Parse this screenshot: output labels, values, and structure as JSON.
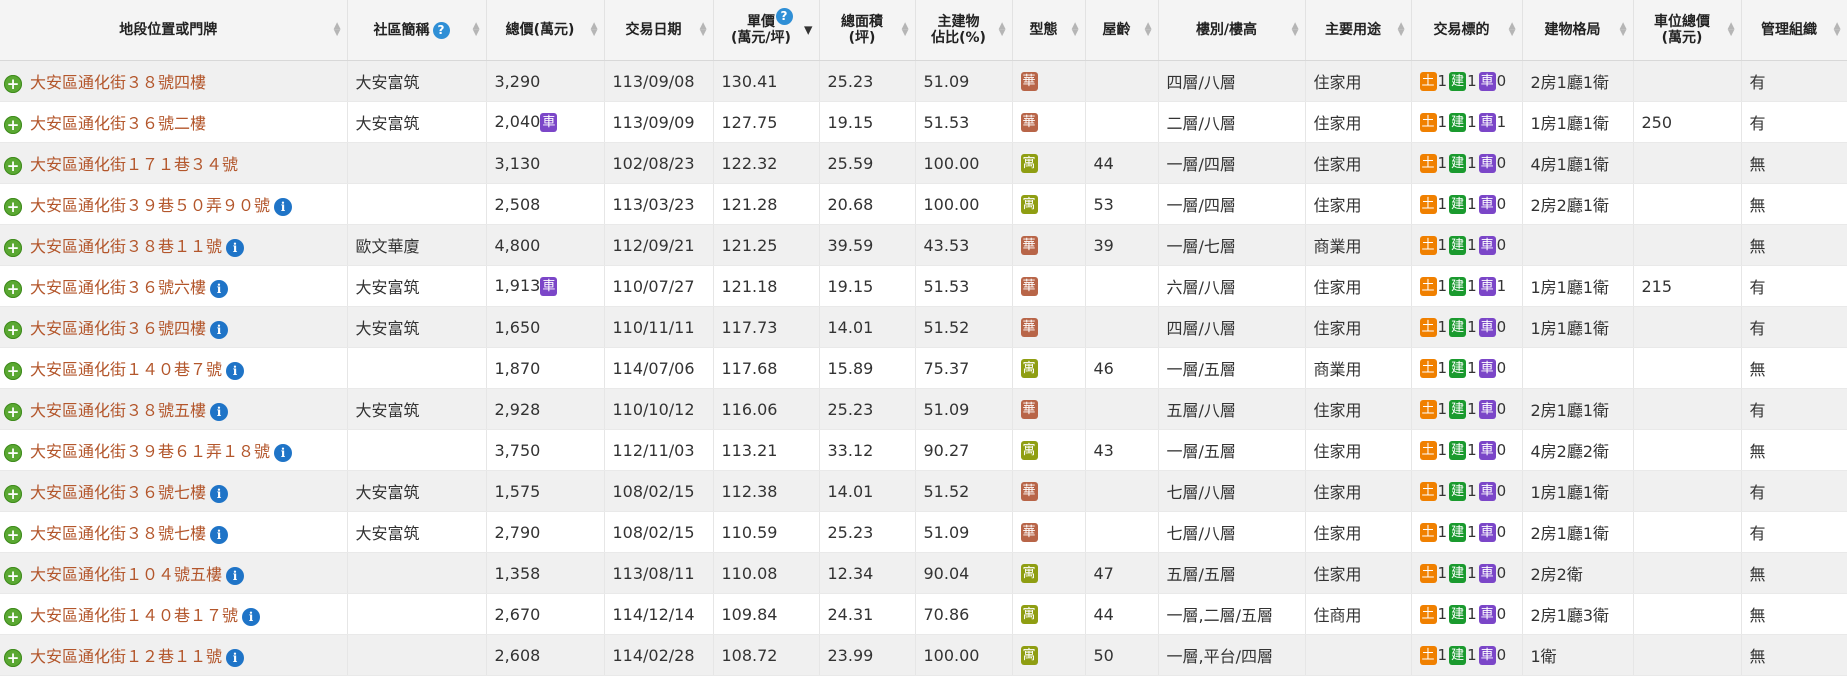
{
  "headers": {
    "address": "地段位置或門牌",
    "community": "社區簡稱",
    "total_price": "總價(萬元)",
    "date": "交易日期",
    "unit_price": "單價\n(萬元/坪)",
    "area": "總面積\n(坪)",
    "main_ratio": "主建物\n佔比(%)",
    "type": "型態",
    "age": "屋齡",
    "floor": "樓別/樓高",
    "usage": "主要用途",
    "target": "交易標的",
    "layout": "建物格局",
    "parking_price": "車位總價\n(萬元)",
    "management": "管理組織"
  },
  "badges": {
    "hua": "華",
    "yu": "寓",
    "che": "車",
    "land": "土",
    "building": "建"
  },
  "colors": {
    "address_text": "#b3562b",
    "hua": "#b86548",
    "yu": "#8f9e12",
    "che": "#7b46c8",
    "land": "#f08000",
    "building": "#1a9a2e",
    "plus": "#5aa832",
    "info": "#1f74c7"
  },
  "icons": {
    "expand": "plus-circle-icon",
    "info": "info-icon",
    "help": "question-icon",
    "sort": "sort-arrows-icon"
  },
  "rows": [
    {
      "address": "大安區通化街３８號四樓",
      "info": false,
      "community": "大安富筑",
      "total": "3,290",
      "parking": false,
      "date": "113/09/08",
      "unit": "130.41",
      "area": "25.23",
      "ratio": "51.09",
      "type": "hua",
      "age": "",
      "floor": "四層/八層",
      "usage": "住家用",
      "land": "1",
      "bld": "1",
      "car": "0",
      "layout": "2房1廳1衛",
      "parking_price": "",
      "mgmt": "有"
    },
    {
      "address": "大安區通化街３６號二樓",
      "info": false,
      "community": "大安富筑",
      "total": "2,040",
      "parking": true,
      "date": "113/09/09",
      "unit": "127.75",
      "area": "19.15",
      "ratio": "51.53",
      "type": "hua",
      "age": "",
      "floor": "二層/八層",
      "usage": "住家用",
      "land": "1",
      "bld": "1",
      "car": "1",
      "layout": "1房1廳1衛",
      "parking_price": "250",
      "mgmt": "有"
    },
    {
      "address": "大安區通化街１７１巷３４號",
      "info": false,
      "community": "",
      "total": "3,130",
      "parking": false,
      "date": "102/08/23",
      "unit": "122.32",
      "area": "25.59",
      "ratio": "100.00",
      "type": "yu",
      "age": "44",
      "floor": "一層/四層",
      "usage": "住家用",
      "land": "1",
      "bld": "1",
      "car": "0",
      "layout": "4房1廳1衛",
      "parking_price": "",
      "mgmt": "無"
    },
    {
      "address": "大安區通化街３９巷５０弄９０號",
      "info": true,
      "community": "",
      "total": "2,508",
      "parking": false,
      "date": "113/03/23",
      "unit": "121.28",
      "area": "20.68",
      "ratio": "100.00",
      "type": "yu",
      "age": "53",
      "floor": "一層/四層",
      "usage": "住家用",
      "land": "1",
      "bld": "1",
      "car": "0",
      "layout": "2房2廳1衛",
      "parking_price": "",
      "mgmt": "無"
    },
    {
      "address": "大安區通化街３８巷１１號",
      "info": true,
      "community": "歐文華廈",
      "total": "4,800",
      "parking": false,
      "date": "112/09/21",
      "unit": "121.25",
      "area": "39.59",
      "ratio": "43.53",
      "type": "hua",
      "age": "39",
      "floor": "一層/七層",
      "usage": "商業用",
      "land": "1",
      "bld": "1",
      "car": "0",
      "layout": "",
      "parking_price": "",
      "mgmt": "無"
    },
    {
      "address": "大安區通化街３６號六樓",
      "info": true,
      "community": "大安富筑",
      "total": "1,913",
      "parking": true,
      "date": "110/07/27",
      "unit": "121.18",
      "area": "19.15",
      "ratio": "51.53",
      "type": "hua",
      "age": "",
      "floor": "六層/八層",
      "usage": "住家用",
      "land": "1",
      "bld": "1",
      "car": "1",
      "layout": "1房1廳1衛",
      "parking_price": "215",
      "mgmt": "有"
    },
    {
      "address": "大安區通化街３６號四樓",
      "info": true,
      "community": "大安富筑",
      "total": "1,650",
      "parking": false,
      "date": "110/11/11",
      "unit": "117.73",
      "area": "14.01",
      "ratio": "51.52",
      "type": "hua",
      "age": "",
      "floor": "四層/八層",
      "usage": "住家用",
      "land": "1",
      "bld": "1",
      "car": "0",
      "layout": "1房1廳1衛",
      "parking_price": "",
      "mgmt": "有"
    },
    {
      "address": "大安區通化街１４０巷７號",
      "info": true,
      "community": "",
      "total": "1,870",
      "parking": false,
      "date": "114/07/06",
      "unit": "117.68",
      "area": "15.89",
      "ratio": "75.37",
      "type": "yu",
      "age": "46",
      "floor": "一層/五層",
      "usage": "商業用",
      "land": "1",
      "bld": "1",
      "car": "0",
      "layout": "",
      "parking_price": "",
      "mgmt": "無"
    },
    {
      "address": "大安區通化街３８號五樓",
      "info": true,
      "community": "大安富筑",
      "total": "2,928",
      "parking": false,
      "date": "110/10/12",
      "unit": "116.06",
      "area": "25.23",
      "ratio": "51.09",
      "type": "hua",
      "age": "",
      "floor": "五層/八層",
      "usage": "住家用",
      "land": "1",
      "bld": "1",
      "car": "0",
      "layout": "2房1廳1衛",
      "parking_price": "",
      "mgmt": "有"
    },
    {
      "address": "大安區通化街３９巷６１弄１８號",
      "info": true,
      "community": "",
      "total": "3,750",
      "parking": false,
      "date": "112/11/03",
      "unit": "113.21",
      "area": "33.12",
      "ratio": "90.27",
      "type": "yu",
      "age": "43",
      "floor": "一層/五層",
      "usage": "住家用",
      "land": "1",
      "bld": "1",
      "car": "0",
      "layout": "4房2廳2衛",
      "parking_price": "",
      "mgmt": "無"
    },
    {
      "address": "大安區通化街３６號七樓",
      "info": true,
      "community": "大安富筑",
      "total": "1,575",
      "parking": false,
      "date": "108/02/15",
      "unit": "112.38",
      "area": "14.01",
      "ratio": "51.52",
      "type": "hua",
      "age": "",
      "floor": "七層/八層",
      "usage": "住家用",
      "land": "1",
      "bld": "1",
      "car": "0",
      "layout": "1房1廳1衛",
      "parking_price": "",
      "mgmt": "有"
    },
    {
      "address": "大安區通化街３８號七樓",
      "info": true,
      "community": "大安富筑",
      "total": "2,790",
      "parking": false,
      "date": "108/02/15",
      "unit": "110.59",
      "area": "25.23",
      "ratio": "51.09",
      "type": "hua",
      "age": "",
      "floor": "七層/八層",
      "usage": "住家用",
      "land": "1",
      "bld": "1",
      "car": "0",
      "layout": "2房1廳1衛",
      "parking_price": "",
      "mgmt": "有"
    },
    {
      "address": "大安區通化街１０４號五樓",
      "info": true,
      "community": "",
      "total": "1,358",
      "parking": false,
      "date": "113/08/11",
      "unit": "110.08",
      "area": "12.34",
      "ratio": "90.04",
      "type": "yu",
      "age": "47",
      "floor": "五層/五層",
      "usage": "住家用",
      "land": "1",
      "bld": "1",
      "car": "0",
      "layout": "2房2衛",
      "parking_price": "",
      "mgmt": "無"
    },
    {
      "address": "大安區通化街１４０巷１７號",
      "info": true,
      "community": "",
      "total": "2,670",
      "parking": false,
      "date": "114/12/14",
      "unit": "109.84",
      "area": "24.31",
      "ratio": "70.86",
      "type": "yu",
      "age": "44",
      "floor": "一層,二層/五層",
      "usage": "住商用",
      "land": "1",
      "bld": "1",
      "car": "0",
      "layout": "2房1廳3衛",
      "parking_price": "",
      "mgmt": "無"
    },
    {
      "address": "大安區通化街１２巷１１號",
      "info": true,
      "community": "",
      "total": "2,608",
      "parking": false,
      "date": "114/02/28",
      "unit": "108.72",
      "area": "23.99",
      "ratio": "100.00",
      "type": "yu",
      "age": "50",
      "floor": "一層,平台/四層",
      "usage": "",
      "land": "1",
      "bld": "1",
      "car": "0",
      "layout": "1衛",
      "parking_price": "",
      "mgmt": "無"
    }
  ]
}
